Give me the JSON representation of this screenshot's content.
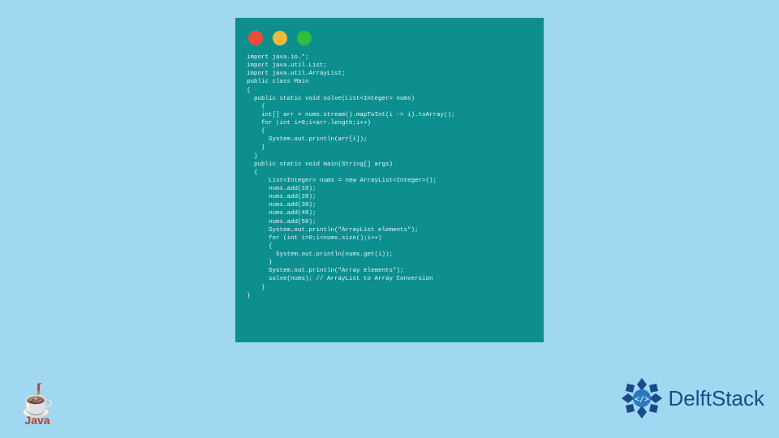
{
  "window": {
    "lights": [
      "red",
      "yellow",
      "green"
    ]
  },
  "code": {
    "lines": [
      "import java.io.*;",
      "import java.util.List;",
      "import java.util.ArrayList;",
      "public class Main",
      "{",
      "  public static void solve(List<Integer> nums)",
      "    {",
      "    int[] arr = nums.stream().mapToInt(i -> i).toArray();",
      "    for (int i=0;i<arr.length;i++)",
      "    {",
      "      System.out.println(arr[i]);",
      "    }",
      "  }",
      "  public static void main(String[] args)",
      "  {",
      "      List<Integer> nums = new ArrayList<Integer>();",
      "      nums.add(10);",
      "      nums.add(20);",
      "      nums.add(30);",
      "      nums.add(40);",
      "      nums.add(50);",
      "      System.out.println(\"ArrayList elements\");",
      "      for (int i=0;i<nums.size();i++)",
      "      {",
      "        System.out.println(nums.get(i));",
      "      }",
      "      System.out.println(\"Array elements\");",
      "      solve(nums); // ArrayList to Array Conversion",
      "    }",
      "}"
    ]
  },
  "logos": {
    "java_label": "Java",
    "delft_label": "DelftStack"
  },
  "colors": {
    "background": "#9fd8f0",
    "window_bg": "#0d8f8f",
    "red": "#f24b3a",
    "yellow": "#f2b93a",
    "green": "#2fbf3a",
    "java": "#c73a2b",
    "delft": "#1b4a8a"
  }
}
